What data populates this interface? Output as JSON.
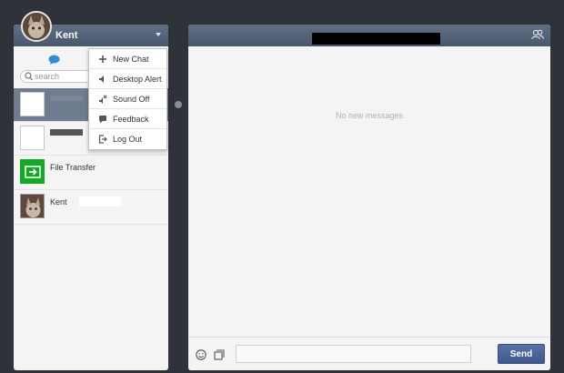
{
  "user": {
    "name": "Kent"
  },
  "search": {
    "placeholder": "search"
  },
  "menu": {
    "items": [
      {
        "label": "New Chat",
        "icon": "plus-icon"
      },
      {
        "label": "Desktop Alert",
        "icon": "speaker-icon"
      },
      {
        "label": "Sound Off",
        "icon": "sound-off-icon"
      },
      {
        "label": "Feedback",
        "icon": "feedback-icon"
      },
      {
        "label": "Log Out",
        "icon": "logout-icon"
      }
    ]
  },
  "list": {
    "items": [
      {
        "name": "",
        "selected": true
      },
      {
        "name": "",
        "selected": false
      },
      {
        "name": "File Transfer",
        "icon": "file-transfer-icon"
      },
      {
        "name": "Kent"
      }
    ]
  },
  "chat": {
    "empty_text": "No new messages"
  },
  "composer": {
    "input_value": "",
    "send_label": "Send"
  },
  "colors": {
    "background": "#2f3238",
    "header": "#5a6a80",
    "selected_row": "#6f7b8f",
    "accent_green": "#11aa22",
    "send_button": "#4d65a0"
  }
}
